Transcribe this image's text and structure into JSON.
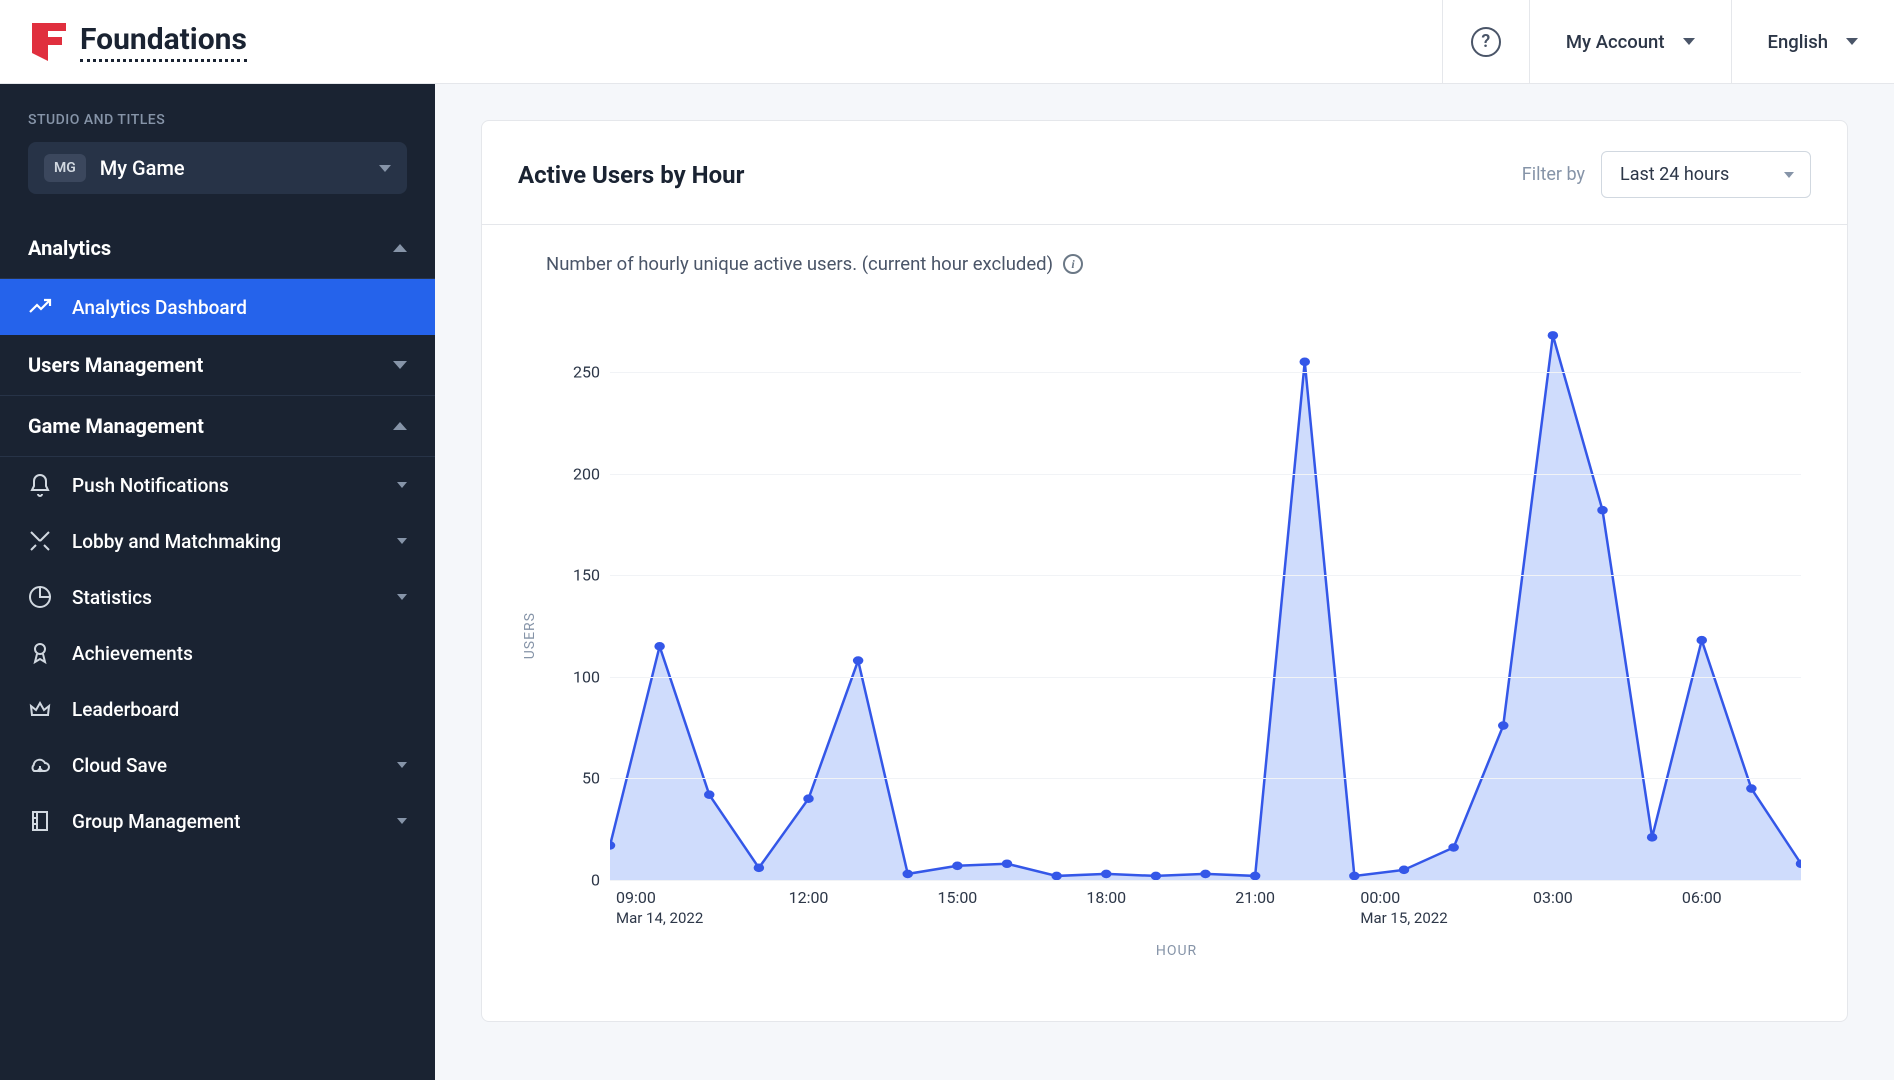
{
  "brand": {
    "name": "Foundations"
  },
  "topbar": {
    "account_label": "My Account",
    "language_label": "English"
  },
  "sidebar": {
    "studio_label": "STUDIO AND TITLES",
    "game_badge": "MG",
    "game_name": "My Game",
    "sections": {
      "analytics": {
        "title": "Analytics",
        "items": [
          {
            "label": "Analytics Dashboard"
          }
        ]
      },
      "users": {
        "title": "Users Management"
      },
      "game_mgmt": {
        "title": "Game Management",
        "items": [
          {
            "label": "Push Notifications"
          },
          {
            "label": "Lobby and Matchmaking"
          },
          {
            "label": "Statistics"
          },
          {
            "label": "Achievements"
          },
          {
            "label": "Leaderboard"
          },
          {
            "label": "Cloud Save"
          },
          {
            "label": "Group Management"
          }
        ]
      }
    }
  },
  "card": {
    "title": "Active Users by Hour",
    "filter_label": "Filter by",
    "filter_value": "Last 24 hours",
    "caption": "Number of hourly unique active users. (current hour excluded)"
  },
  "chart_data": {
    "type": "area",
    "xlabel": "HOUR",
    "ylabel": "USERS",
    "ylim": [
      0,
      280
    ],
    "yticks": [
      0,
      50,
      100,
      150,
      200,
      250
    ],
    "x": [
      "08:00",
      "09:00",
      "10:00",
      "11:00",
      "12:00",
      "13:00",
      "14:00",
      "15:00",
      "16:00",
      "17:00",
      "18:00",
      "19:00",
      "20:00",
      "21:00",
      "22:00",
      "23:00",
      "00:00",
      "01:00",
      "02:00",
      "03:00",
      "04:00",
      "05:00",
      "06:00",
      "07:00",
      "08:00"
    ],
    "values": [
      17,
      115,
      42,
      6,
      40,
      108,
      3,
      7,
      8,
      2,
      3,
      2,
      3,
      2,
      255,
      2,
      5,
      16,
      76,
      268,
      182,
      21,
      118,
      45,
      8
    ],
    "x_tick_labels": [
      {
        "at": "09:00",
        "label": "09:00",
        "sub": "Mar 14, 2022"
      },
      {
        "at": "12:00",
        "label": "12:00"
      },
      {
        "at": "15:00",
        "label": "15:00"
      },
      {
        "at": "18:00",
        "label": "18:00"
      },
      {
        "at": "21:00",
        "label": "21:00"
      },
      {
        "at": "00:00",
        "label": "00:00",
        "sub": "Mar 15, 2022"
      },
      {
        "at": "03:00",
        "label": "03:00"
      },
      {
        "at": "06:00",
        "label": "06:00"
      }
    ],
    "colors": {
      "line": "#3457e8",
      "area": "#c7d6fb"
    }
  }
}
